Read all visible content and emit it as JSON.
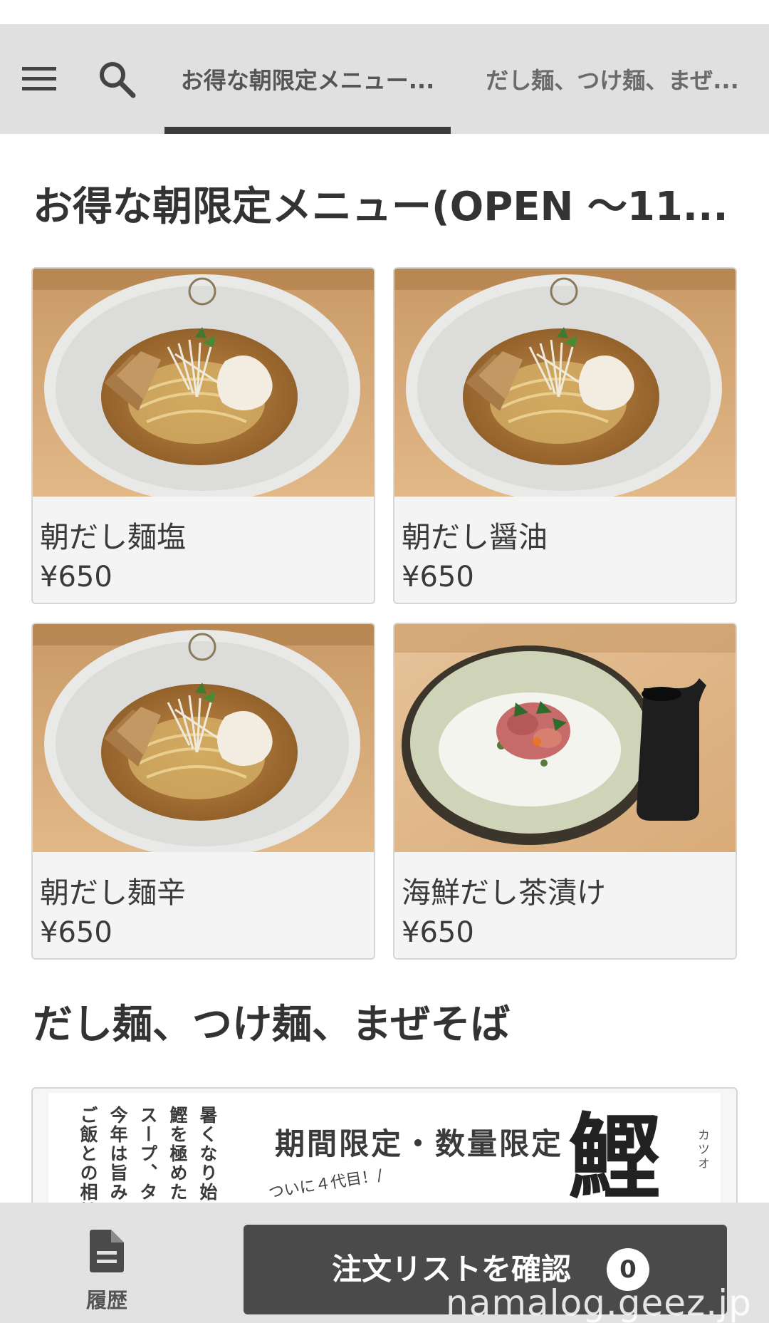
{
  "header": {
    "menu_icon": "hamburger-menu-icon",
    "search_icon": "search-icon",
    "tabs": [
      {
        "label": "お得な朝限定メニュー...",
        "active": true
      },
      {
        "label": "だし麺、つけ麺、まぜ...",
        "active": false
      }
    ]
  },
  "sections": [
    {
      "title": "お得な朝限定メニュー(OPEN 〜11...",
      "items": [
        {
          "name": "朝だし麺塩",
          "price": "¥650",
          "image": "ramen-bowl-photo"
        },
        {
          "name": "朝だし醤油",
          "price": "¥650",
          "image": "ramen-bowl-photo"
        },
        {
          "name": "朝だし麺辛",
          "price": "¥650",
          "image": "ramen-bowl-photo"
        },
        {
          "name": "海鮮だし茶漬け",
          "price": "¥650",
          "image": "seafood-rice-bowl-photo"
        }
      ]
    },
    {
      "title": "だし麺、つけ麺、まぜそば",
      "banner": {
        "heading": "期間限定・数量限定",
        "sub": "ついに４代目！/",
        "kanji": "鰹",
        "reading": "カツオ",
        "vertical_lines": [
          "暑くなり始める",
          "鰹を極めた「",
          "スープ、タレ、",
          "今年は旨みもさ",
          "ご飯との相性も"
        ]
      }
    }
  ],
  "bottom_bar": {
    "history_icon": "document-icon",
    "history_label": "履歴",
    "order_button_label": "注文リストを確認",
    "order_count": "0"
  },
  "watermark": "namalog.geez.jp",
  "colors": {
    "topbar_bg": "#e0e0e0",
    "tab_indicator": "#3c3c3c",
    "order_button_bg": "#4a4a4a",
    "card_bg": "#f4f4f4"
  }
}
